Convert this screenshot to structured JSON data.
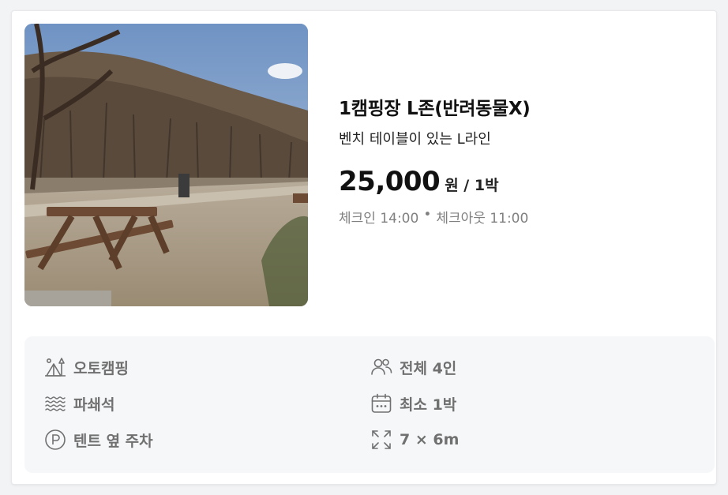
{
  "listing": {
    "title": "1캠핑장 L존(반려동물X)",
    "subtitle": "벤치 테이블이 있는 L라인",
    "price": "25,000",
    "price_unit": "원 / 1박",
    "checkin": "체크인 14:00",
    "separator": "•",
    "checkout": "체크아웃 11:00"
  },
  "features": {
    "left": [
      {
        "icon": "tent-camping-icon",
        "label": "오토캠핑"
      },
      {
        "icon": "gravel-icon",
        "label": "파쇄석"
      },
      {
        "icon": "parking-icon",
        "label": "텐트 옆 주차"
      }
    ],
    "right": [
      {
        "icon": "people-icon",
        "label": "전체 4인"
      },
      {
        "icon": "calendar-icon",
        "label": "최소 1박"
      },
      {
        "icon": "expand-icon",
        "label": "7 × 6m"
      }
    ]
  },
  "colors": {
    "feature_bg": "#f6f7f9",
    "icon_gray": "#707070",
    "text_gray": "#808080"
  }
}
